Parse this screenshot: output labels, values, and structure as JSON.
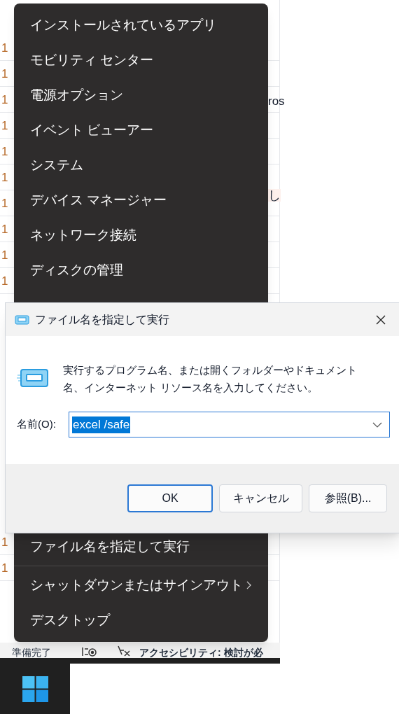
{
  "spreadsheet": {
    "upper_row_numbers": [
      "1",
      "1",
      "1",
      "1",
      "1",
      "1",
      "1",
      "1",
      "1",
      "1"
    ],
    "lower_row_numbers": [
      "1",
      "1"
    ],
    "cell_fragments": [
      {
        "text": "ros",
        "kind": "plain"
      },
      {
        "text": "し",
        "kind": "flagged"
      }
    ]
  },
  "context_menu": {
    "items": [
      {
        "label": "インストールされているアプリ"
      },
      {
        "label": "モビリティ センター"
      },
      {
        "label": "電源オプション"
      },
      {
        "label": "イベント ビューアー"
      },
      {
        "label": "システム"
      },
      {
        "label": "デバイス マネージャー"
      },
      {
        "label": "ネットワーク接続"
      },
      {
        "label": "ディスクの管理"
      }
    ],
    "lower_items": [
      {
        "label": "ファイル名を指定して実行",
        "submenu": false,
        "separator_after": true
      },
      {
        "label": "シャットダウンまたはサインアウト",
        "submenu": true,
        "separator_after": false
      },
      {
        "label": "デスクトップ",
        "submenu": false,
        "separator_after": false
      }
    ]
  },
  "run_dialog": {
    "title": "ファイル名を指定して実行",
    "message": "実行するプログラム名、または開くフォルダーやドキュメント名、インターネット リソース名を入力してください。",
    "name_label": "名前(O):",
    "input": {
      "value": "excel /safe",
      "selected": true
    },
    "buttons": [
      {
        "label": "OK",
        "default": true
      },
      {
        "label": "キャンセル",
        "default": false
      },
      {
        "label": "参照(B)...",
        "default": false
      }
    ]
  },
  "status_bar": {
    "status": "準備完了",
    "accessibility": "アクセシビリティ: 検討が必"
  }
}
